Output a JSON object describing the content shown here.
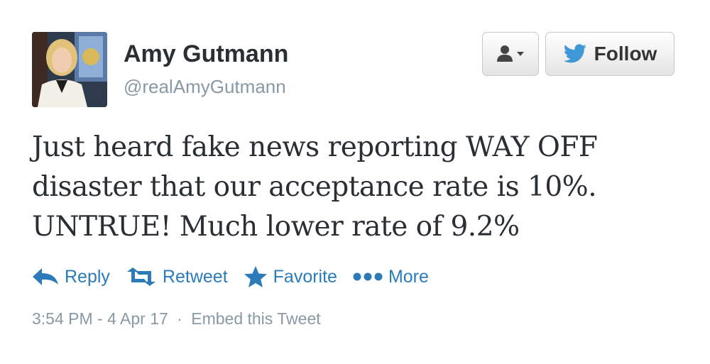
{
  "user": {
    "full_name": "Amy Gutmann",
    "screen_name": "@realAmyGutmann",
    "avatar_icon": "profile-photo"
  },
  "buttons": {
    "user_dropdown_icon": "person-dropdown-icon",
    "follow_label": "Follow",
    "follow_icon": "twitter-bird-icon"
  },
  "tweet": {
    "lines": [
      "Just heard fake news reporting WAY OFF",
      "disaster that our acceptance rate is 10%.",
      "UNTRUE! Much lower rate of 9.2%"
    ]
  },
  "actions": {
    "reply": "Reply",
    "retweet": "Retweet",
    "favorite": "Favorite",
    "more": "More"
  },
  "meta": {
    "timestamp": "3:54 PM - 4 Apr 17",
    "separator": "·",
    "embed": "Embed this Tweet"
  },
  "colors": {
    "link": "#2b7bb9",
    "text": "#292f33",
    "muted": "#8899a6",
    "bird": "#4099d6"
  }
}
